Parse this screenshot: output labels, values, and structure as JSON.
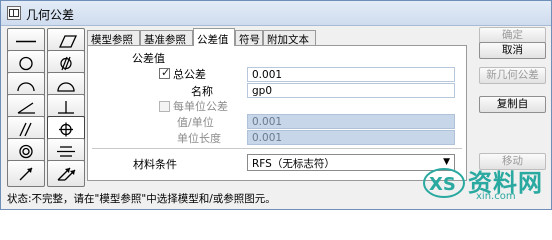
{
  "window": {
    "title": "几何公差"
  },
  "toolbar": {
    "buttons": [
      {
        "name": "straightness-tool"
      },
      {
        "name": "flatness-tool"
      },
      {
        "name": "circularity-tool"
      },
      {
        "name": "cylindricity-tool"
      },
      {
        "name": "line-profile-tool"
      },
      {
        "name": "surface-profile-tool"
      },
      {
        "name": "angularity-tool"
      },
      {
        "name": "perpendicularity-tool"
      },
      {
        "name": "parallelism-tool"
      },
      {
        "name": "position-tool",
        "selected": true
      },
      {
        "name": "concentricity-tool"
      },
      {
        "name": "symmetry-tool"
      },
      {
        "name": "circular-runout-tool"
      },
      {
        "name": "total-runout-tool"
      }
    ]
  },
  "tabs": [
    {
      "label": "模型参照",
      "active": false
    },
    {
      "label": "基准参照",
      "active": false
    },
    {
      "label": "公差值",
      "active": true
    },
    {
      "label": "符号",
      "active": false
    },
    {
      "label": "附加文本",
      "active": false
    }
  ],
  "tolerance": {
    "section_label": "公差值",
    "total_label": "总公差",
    "total_checked": true,
    "total_value": "0.001",
    "name_label": "名称",
    "name_value": "gp0",
    "per_unit_label": "每单位公差",
    "per_unit_checked": false,
    "value_per_unit_label": "值/单位",
    "value_per_unit_value": "0.001",
    "unit_length_label": "单位长度",
    "unit_length_value": "0.001",
    "material_label": "材料条件",
    "material_value": "RFS（无标志符）"
  },
  "right_buttons": {
    "ok": "确定",
    "cancel": "取消",
    "new": "新几何公差",
    "copy_from": "复制自",
    "move": "移动"
  },
  "status": "状态:不完整，请在\"模型参照\"中选择模型和/或参照图元。",
  "watermark": {
    "text": "资料网",
    "sub": "xin.com"
  }
}
